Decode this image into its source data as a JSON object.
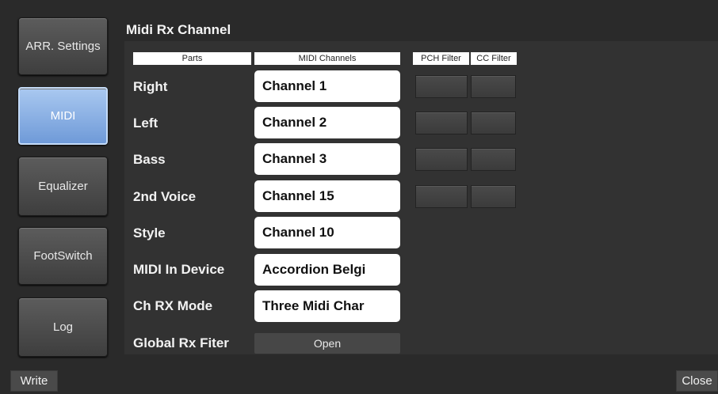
{
  "sidebar": {
    "items": [
      {
        "label": "ARR. Settings",
        "active": false
      },
      {
        "label": "MIDI",
        "active": true
      },
      {
        "label": "Equalizer",
        "active": false
      },
      {
        "label": "FootSwitch",
        "active": false
      },
      {
        "label": "Log",
        "active": false
      }
    ]
  },
  "panel": {
    "title": "Midi Rx Channel",
    "headers": {
      "parts": "Parts",
      "midi_channels": "MIDI Channels",
      "pch_filter": "PCH Filter",
      "cc_filter": "CC Filter"
    },
    "rows": [
      {
        "label": "Right",
        "value": "Channel 1"
      },
      {
        "label": "Left",
        "value": "Channel 2"
      },
      {
        "label": "Bass",
        "value": "Channel 3"
      },
      {
        "label": "2nd Voice",
        "value": "Channel 15"
      },
      {
        "label": "Style",
        "value": "Channel 10"
      },
      {
        "label": "MIDI In Device",
        "value": "Accordion Belgi"
      },
      {
        "label": "Ch RX Mode",
        "value": "Three Midi Char"
      }
    ],
    "global_rx_filter": {
      "label": "Global Rx Fiter",
      "value": "Open"
    }
  },
  "footer": {
    "write_label": "Write",
    "close_label": "Close"
  },
  "colors": {
    "background": "#2a2a2a",
    "panel": "#323232",
    "active_accent": "#8fb4e8"
  }
}
